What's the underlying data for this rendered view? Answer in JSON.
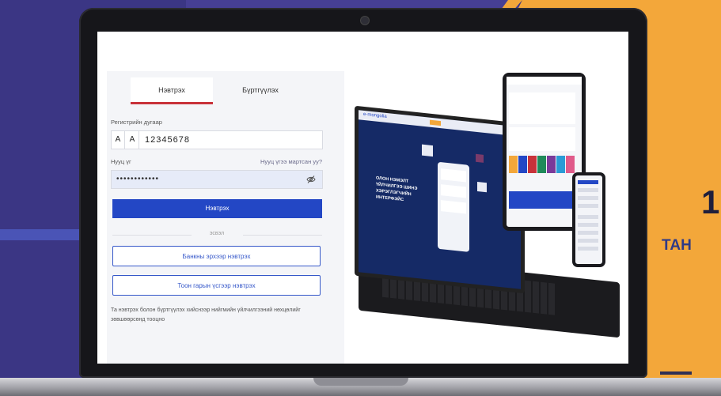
{
  "login": {
    "tabs": [
      {
        "label": "Нэвтрэх",
        "active": true
      },
      {
        "label": "Бүртгүүлэх",
        "active": false
      }
    ],
    "register_label": "Регистрийн дугаар",
    "register_letter_1": "А",
    "register_letter_2": "А",
    "register_value": "12345678",
    "password_label": "Нууц үг",
    "forgot_password": "Нууц үгээ мартсан уу?",
    "password_value": "••••••••••••",
    "login_button": "Нэвтрэх",
    "divider_text": "эсвэл",
    "bank_login_button": "Банкны эрхээр нэвтрэх",
    "digital_sign_button": "Тоон гарын үсгээр нэвтрэх",
    "footnote": "Та нэвтрэх болон бүртгүүлэх хийснээр нийгмийн үйлчилгээний нөхцөлийг зөвшөөрсөнд тооцно"
  },
  "mockup": {
    "logo": "e-mongolia",
    "headline": "ОЛОН НЭМЭЛТ ҮЙЛЧИЛГЭЭ ШИНЭ ХЭРЭГЛЭГЧИЙН ИНТЕРФЭЙС"
  },
  "side": {
    "big_text": "1",
    "small_text": "ТАН"
  },
  "colors": {
    "background": "#3b3684",
    "accent_orange": "#f3a73a",
    "primary_blue": "#2347c5",
    "active_tab_red": "#c8323a"
  }
}
